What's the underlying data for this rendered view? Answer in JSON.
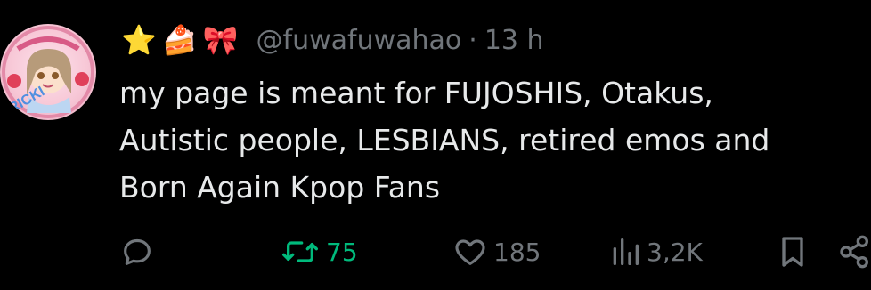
{
  "author": {
    "emojis": [
      "⭐",
      "🍰",
      "🎀"
    ],
    "handle": "@fuwafuwahao",
    "separator": "·",
    "time": "13 h",
    "avatar_text": "RICKI"
  },
  "tweet": {
    "text": "my page is meant for FUJOSHIS, Otakus,\nAutistic people, LESBIANS, retired emos and\nBorn Again Kpop Fans"
  },
  "actions": {
    "reply_count": "",
    "retweet_count": "75",
    "like_count": "185",
    "view_count": "3,2K"
  },
  "colors": {
    "background": "#000000",
    "text": "#e7e9ea",
    "muted": "#71767b",
    "retweet_active": "#00ba7c"
  },
  "icons": [
    "reply-icon",
    "retweet-icon",
    "like-icon",
    "views-icon",
    "bookmark-icon",
    "share-icon"
  ]
}
